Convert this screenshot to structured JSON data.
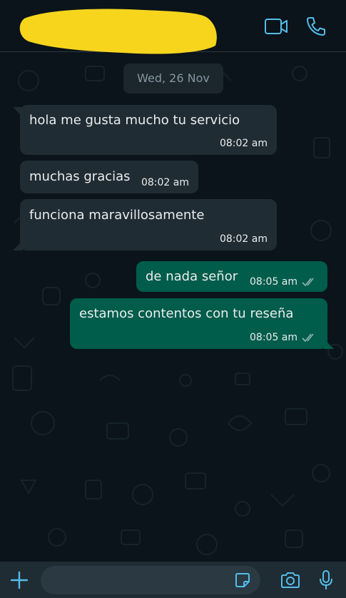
{
  "header": {
    "contact_name_redacted": true,
    "video_call_icon": "video-camera-icon",
    "voice_call_icon": "phone-icon"
  },
  "date_divider": "Wed, 26 Nov",
  "messages": [
    {
      "direction": "incoming",
      "text": "hola me gusta mucho tu servicio",
      "time": "08:02 am"
    },
    {
      "direction": "incoming",
      "text": "muchas gracias",
      "time": "08:02 am"
    },
    {
      "direction": "incoming",
      "text": "funciona maravillosamente",
      "time": "08:02 am"
    },
    {
      "direction": "outgoing",
      "text": "de nada señor",
      "time": "08:05 am",
      "status": "read"
    },
    {
      "direction": "outgoing",
      "text": "estamos contentos con tu reseña",
      "time": "08:05 am",
      "status": "read"
    }
  ],
  "composer": {
    "placeholder": "",
    "attach_icon": "plus-icon",
    "sticker_icon": "sticker-icon",
    "camera_icon": "camera-icon",
    "mic_icon": "microphone-icon"
  },
  "colors": {
    "background": "#0b141a",
    "incoming_bubble": "#202c33",
    "outgoing_bubble": "#005c4b",
    "accent": "#53bdeb",
    "redaction": "#f7d51d"
  }
}
